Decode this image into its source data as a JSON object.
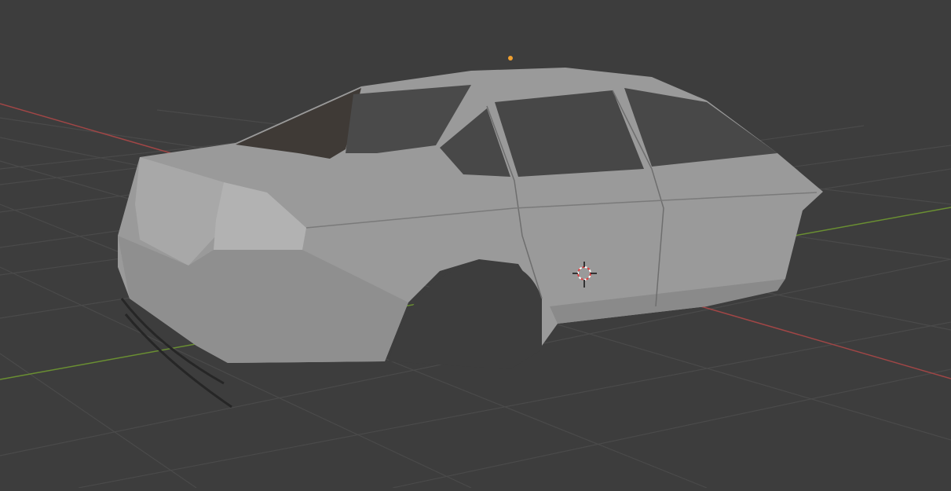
{
  "viewport": {
    "background_color": "#3d3d3d",
    "grid_color": "#4a4a4a",
    "x_axis_color": "#a04646",
    "y_axis_color": "#6a8f32",
    "model": {
      "body_color": "#9c9c9c",
      "highlight_color": "#b4b4b4",
      "shadow_color": "#7e7e7e",
      "glass_color": "#3f3a36"
    },
    "icons": [
      "origin-dot-icon",
      "3d-cursor-icon"
    ],
    "origin_color": "#f0a030"
  }
}
